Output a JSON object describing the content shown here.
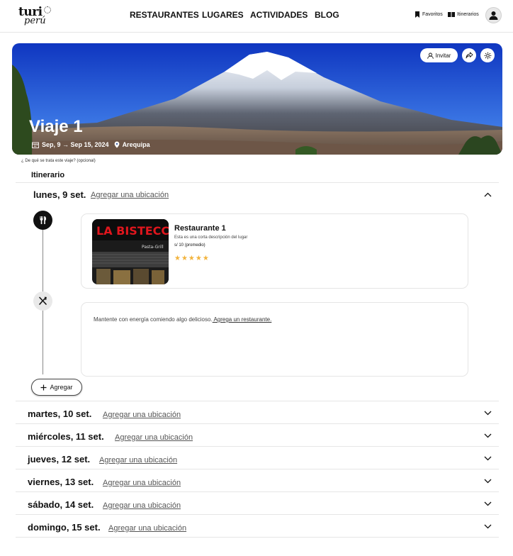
{
  "header": {
    "logo_top": "turi",
    "logo_bottom": "perú",
    "nav": [
      "RESTAURANTES",
      "LUGARES",
      "ACTIVIDADES",
      "BLOG"
    ],
    "favorites_label": "Favoritos",
    "itineraries_label": "Itinerarios"
  },
  "hero": {
    "title": "Viaje 1",
    "dates": "Sep, 9 → Sep 15, 2024",
    "location": "Arequipa",
    "invite_label": "Invitar"
  },
  "about_prompt": "¿ De qué se trata este viaje? (opcional)",
  "itinerary_title": "Itinerario",
  "add_location_label": "Agregar una ubicación",
  "days": [
    {
      "label": "lunes, 9 set.",
      "expanded": true
    },
    {
      "label": "martes, 10 set.",
      "expanded": false
    },
    {
      "label": "miércoles, 11 set.",
      "expanded": false
    },
    {
      "label": "jueves, 12 set.",
      "expanded": false
    },
    {
      "label": "viernes, 13 set.",
      "expanded": false
    },
    {
      "label": "sábado, 14 set.",
      "expanded": false
    },
    {
      "label": "domingo, 15 set.",
      "expanded": false
    }
  ],
  "restaurant": {
    "name": "Restaurante 1",
    "description": "Esta es una corta descripción del lugar",
    "price": "s/ 10 (promedio)",
    "rating": 5,
    "stars": "★★★★★",
    "sign_text": "LA BISTECCA",
    "sign_sub": "Pasta-Grill"
  },
  "suggestion": {
    "text": "Mantente con energía comiendo algo delicioso.",
    "link": " Agrega un restaurante."
  },
  "add_button_label": "Agregar",
  "colors": {
    "sky_top": "#1340c8",
    "sky_bottom": "#3a7ef0",
    "star": "#f2b33d",
    "sign_red": "#e0161d"
  }
}
